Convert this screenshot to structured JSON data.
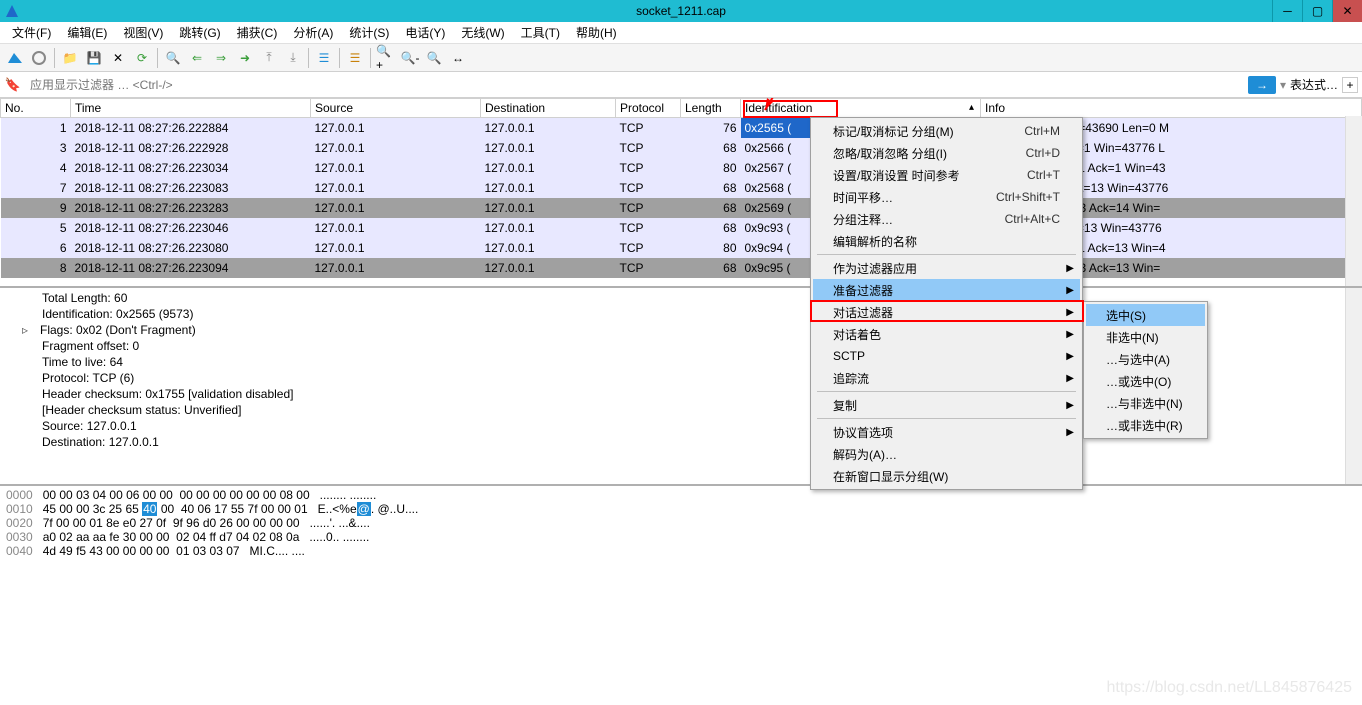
{
  "title": "socket_1211.cap",
  "menus": [
    "文件(F)",
    "编辑(E)",
    "视图(V)",
    "跳转(G)",
    "捕获(C)",
    "分析(A)",
    "统计(S)",
    "电话(Y)",
    "无线(W)",
    "工具(T)",
    "帮助(H)"
  ],
  "filter_placeholder": "应用显示过滤器 … <Ctrl-/>",
  "expr_label": "表达式…",
  "columns": [
    "No.",
    "Time",
    "Source",
    "Destination",
    "Protocol",
    "Length",
    "Identification",
    "Info"
  ],
  "rows": [
    {
      "no": "1",
      "time": "2018-12-11 08:27:26.222884",
      "src": "127.0.0.1",
      "dst": "127.0.0.1",
      "proto": "TCP",
      "len": "76",
      "ident": "0x2565 (",
      "info": "[SYN] Seq=0 Win=43690 Len=0 M",
      "cls": "row-blue row-sel"
    },
    {
      "no": "3",
      "time": "2018-12-11 08:27:26.222928",
      "src": "127.0.0.1",
      "dst": "127.0.0.1",
      "proto": "TCP",
      "len": "68",
      "ident": "0x2566 (",
      "info": "[ACK] Seq=1 Ack=1 Win=43776 L",
      "cls": "row-blue"
    },
    {
      "no": "4",
      "time": "2018-12-11 08:27:26.223034",
      "src": "127.0.0.1",
      "dst": "127.0.0.1",
      "proto": "TCP",
      "len": "80",
      "ident": "0x2567 (",
      "info": "[PSH, ACK] Seq=1 Ack=1 Win=43",
      "cls": "row-blue"
    },
    {
      "no": "7",
      "time": "2018-12-11 08:27:26.223083",
      "src": "127.0.0.1",
      "dst": "127.0.0.1",
      "proto": "TCP",
      "len": "68",
      "ident": "0x2568 (",
      "info": "[ACK] Seq=13 Ack=13 Win=43776",
      "cls": "row-blue"
    },
    {
      "no": "9",
      "time": "2018-12-11 08:27:26.223283",
      "src": "127.0.0.1",
      "dst": "127.0.0.1",
      "proto": "TCP",
      "len": "68",
      "ident": "0x2569 (",
      "info": "[FIN, ACK] Seq=13 Ack=14 Win=",
      "cls": "row-gray"
    },
    {
      "no": "5",
      "time": "2018-12-11 08:27:26.223046",
      "src": "127.0.0.1",
      "dst": "127.0.0.1",
      "proto": "TCP",
      "len": "68",
      "ident": "0x9c93 (",
      "info": "[ACK] Seq=1 Ack=13 Win=43776 ",
      "cls": "row-blue"
    },
    {
      "no": "6",
      "time": "2018-12-11 08:27:26.223080",
      "src": "127.0.0.1",
      "dst": "127.0.0.1",
      "proto": "TCP",
      "len": "80",
      "ident": "0x9c94 (",
      "info": "[PSH, ACK] Seq=1 Ack=13 Win=4",
      "cls": "row-blue"
    },
    {
      "no": "8",
      "time": "2018-12-11 08:27:26.223094",
      "src": "127.0.0.1",
      "dst": "127.0.0.1",
      "proto": "TCP",
      "len": "68",
      "ident": "0x9c95 (",
      "info": "[FIN, ACK] Seq=13 Ack=13 Win=",
      "cls": "row-gray"
    }
  ],
  "details": [
    "Total Length: 60",
    "Identification: 0x2565 (9573)",
    "Flags: 0x02 (Don't Fragment)",
    "Fragment offset: 0",
    "Time to live: 64",
    "Protocol: TCP (6)",
    "Header checksum: 0x1755 [validation disabled]",
    "[Header checksum status: Unverified]",
    "Source: 127.0.0.1",
    "Destination: 127.0.0.1"
  ],
  "hex": [
    {
      "off": "0000",
      "bytes": "00 00 03 04 00 06 00 00  00 00 00 00 00 00 08 00",
      "ascii": "........ ........"
    },
    {
      "off": "0010",
      "bytes": "45 00 00 3c 25 65 ",
      "hl": "40",
      "bytes2": " 00  40 06 17 55 7f 00 00 01",
      "ascii": "E..<%e",
      "hl2": "@",
      "ascii2": ". @..U...."
    },
    {
      "off": "0020",
      "bytes": "7f 00 00 01 8e e0 27 0f  9f 96 d0 26 00 00 00 00",
      "ascii": "......'. ...&...."
    },
    {
      "off": "0030",
      "bytes": "a0 02 aa aa fe 30 00 00  02 04 ff d7 04 02 08 0a",
      "ascii": ".....0.. ........"
    },
    {
      "off": "0040",
      "bytes": "4d 49 f5 43 00 00 00 00  01 03 03 07",
      "ascii": "MI.C.... ...."
    }
  ],
  "ctx1": [
    {
      "label": "标记/取消标记 分组(M)",
      "sc": "Ctrl+M"
    },
    {
      "label": "忽略/取消忽略 分组(I)",
      "sc": "Ctrl+D"
    },
    {
      "label": "设置/取消设置 时间参考",
      "sc": "Ctrl+T"
    },
    {
      "label": "时间平移…",
      "sc": "Ctrl+Shift+T"
    },
    {
      "label": "分组注释…",
      "sc": "Ctrl+Alt+C"
    },
    {
      "label": "编辑解析的名称"
    },
    {
      "sep": true
    },
    {
      "label": "作为过滤器应用",
      "sub": true
    },
    {
      "label": "准备过滤器",
      "sub": true,
      "hl": true
    },
    {
      "label": "对话过滤器",
      "sub": true
    },
    {
      "label": "对话着色",
      "sub": true
    },
    {
      "label": "SCTP",
      "sub": true
    },
    {
      "label": "追踪流",
      "sub": true
    },
    {
      "sep": true
    },
    {
      "label": "复制",
      "sub": true
    },
    {
      "sep": true
    },
    {
      "label": "协议首选项",
      "sub": true
    },
    {
      "label": "解码为(A)…"
    },
    {
      "label": "在新窗口显示分组(W)"
    }
  ],
  "ctx2": [
    {
      "label": "选中(S)",
      "hl": true
    },
    {
      "label": "非选中(N)"
    },
    {
      "label": "…与选中(A)"
    },
    {
      "label": "…或选中(O)"
    },
    {
      "label": "…与非选中(N)"
    },
    {
      "label": "…或非选中(R)"
    }
  ],
  "watermark": "https://blog.csdn.net/LL845876425"
}
